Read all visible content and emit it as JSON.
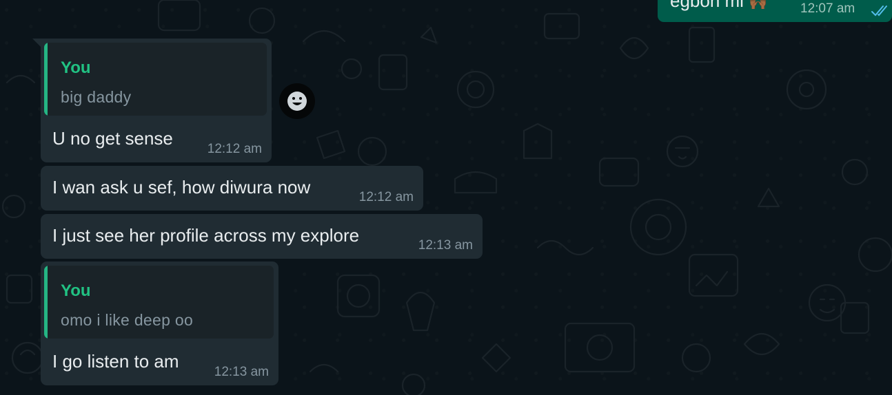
{
  "messages": [
    {
      "direction": "outgoing",
      "text": "egbon mi",
      "emoji": "🙌🏾",
      "time": "12:07 am",
      "status": "double-check-read"
    },
    {
      "direction": "incoming",
      "quote": {
        "author": "You",
        "text": "big daddy"
      },
      "text": "U no get sense",
      "time": "12:12 am"
    },
    {
      "direction": "incoming",
      "text": "I wan ask u sef, how diwura now",
      "time": "12:12 am"
    },
    {
      "direction": "incoming",
      "text": "I just see her profile across my explore",
      "time": "12:13 am"
    },
    {
      "direction": "incoming",
      "quote": {
        "author": "You",
        "text": "omo i like deep oo"
      },
      "text": "I go listen to am",
      "time": "12:13 am"
    }
  ],
  "reaction_button": {
    "icon": "smiley-icon"
  },
  "colors": {
    "background": "#0b141a",
    "incoming_bubble": "#202c33",
    "outgoing_bubble": "#005c4b",
    "quote_accent": "#21c283",
    "read_check": "#53bdeb"
  }
}
